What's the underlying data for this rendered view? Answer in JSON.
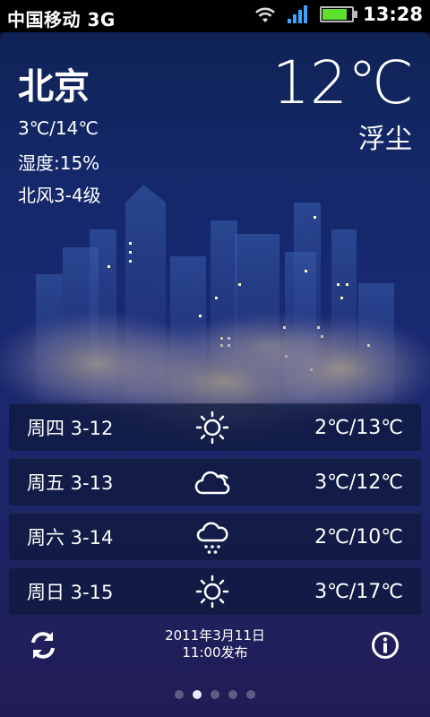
{
  "status_bar": {
    "carrier": "中国移动 3G",
    "time": "13:28",
    "battery_level": 0.85
  },
  "weather": {
    "city": "北京",
    "temp_range": "3℃/14℃",
    "humidity": "湿度:15%",
    "wind": "北风3-4级",
    "current_temp": "12℃",
    "condition": "浮尘"
  },
  "forecast": [
    {
      "day": "周四 3-12",
      "icon": "sunny-icon",
      "temps": "2℃/13℃"
    },
    {
      "day": "周五 3-13",
      "icon": "cloudy-icon",
      "temps": "3℃/12℃"
    },
    {
      "day": "周六 3-14",
      "icon": "rain-cloud-icon",
      "temps": "2℃/10℃"
    },
    {
      "day": "周日 3-15",
      "icon": "sunny-icon",
      "temps": "3℃/17℃"
    }
  ],
  "footer": {
    "publish_date": "2011年3月11日",
    "publish_time": "11:00发布"
  },
  "pager": {
    "total": 5,
    "active": 1
  }
}
